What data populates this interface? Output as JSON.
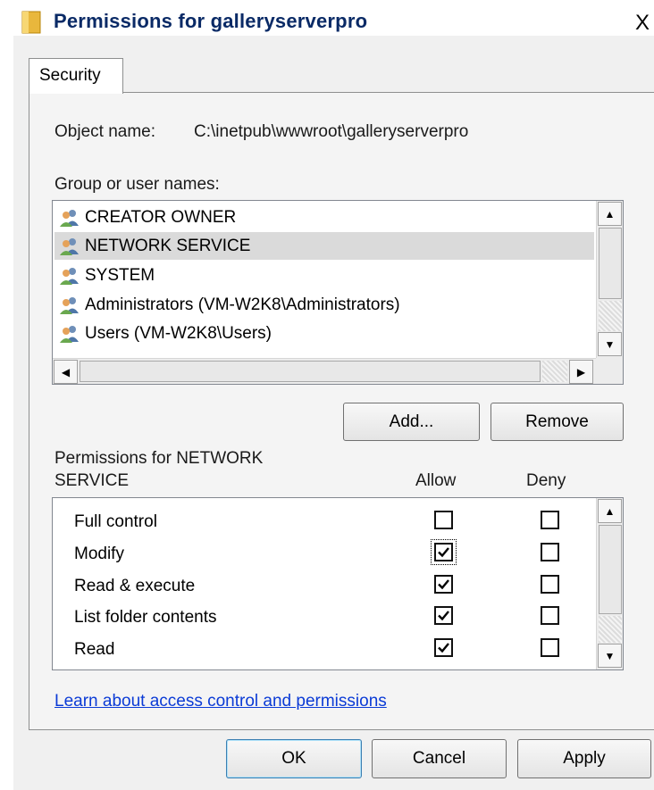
{
  "window": {
    "title": "Permissions for galleryserverpro",
    "close_glyph": "X",
    "icon": "folder-icon"
  },
  "tabs": [
    {
      "label": "Security",
      "selected": true
    }
  ],
  "object": {
    "label": "Object name:",
    "value": "C:\\inetpub\\wwwroot\\galleryserverpro"
  },
  "groups": {
    "label": "Group or user names:",
    "items": [
      {
        "name": "CREATOR OWNER",
        "icon": "user-group-icon",
        "selected": false
      },
      {
        "name": "NETWORK SERVICE",
        "icon": "user-group-icon",
        "selected": true
      },
      {
        "name": "SYSTEM",
        "icon": "user-group-icon",
        "selected": false
      },
      {
        "name": "Administrators (VM-W2K8\\Administrators)",
        "icon": "user-group-icon",
        "selected": false
      },
      {
        "name": "Users (VM-W2K8\\Users)",
        "icon": "user-group-icon",
        "selected": false
      }
    ]
  },
  "buttons": {
    "add": "Add...",
    "remove": "Remove",
    "ok": "OK",
    "cancel": "Cancel",
    "apply": "Apply"
  },
  "permissions": {
    "title_line1": "Permissions for NETWORK",
    "title_line2": "SERVICE",
    "allow_header": "Allow",
    "deny_header": "Deny",
    "rows": [
      {
        "name": "Full control",
        "allow": false,
        "deny": false
      },
      {
        "name": "Modify",
        "allow": true,
        "deny": false,
        "focused": true
      },
      {
        "name": "Read & execute",
        "allow": true,
        "deny": false
      },
      {
        "name": "List folder contents",
        "allow": true,
        "deny": false
      },
      {
        "name": "Read",
        "allow": true,
        "deny": false
      }
    ]
  },
  "link": {
    "text": "Learn about access control and permissions"
  },
  "colors": {
    "title_text": "#0a2a66",
    "link": "#0b3bd6",
    "selection": "#dadada"
  }
}
